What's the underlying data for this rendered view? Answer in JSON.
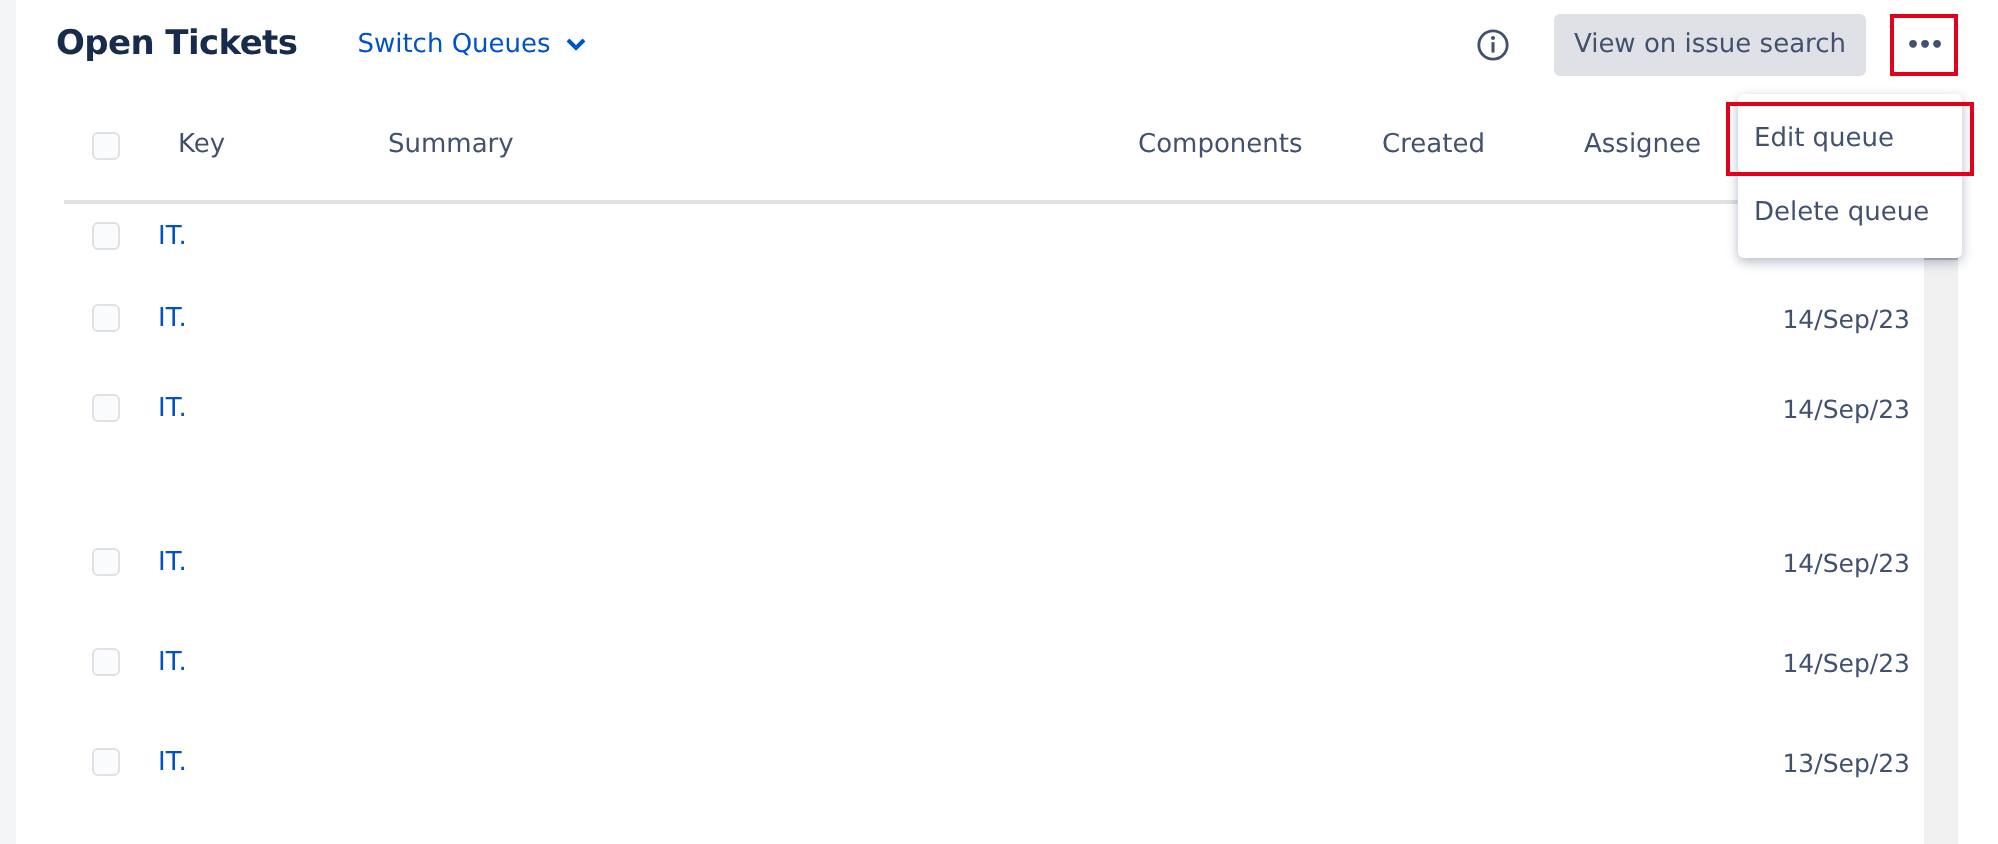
{
  "header": {
    "title": "Open Tickets",
    "switch_label": "Switch Queues",
    "search_button": "View on issue search",
    "more_button": {
      "label": "•••",
      "highlighted": true
    }
  },
  "table": {
    "header_checked": false,
    "columns": [
      "Key",
      "Summary",
      "Components",
      "Created",
      "Assignee"
    ],
    "rows": [
      {
        "checked": false,
        "key": "IT."
      },
      {
        "checked": false,
        "key": "IT.",
        "date": "14/Sep/23"
      },
      {
        "checked": false,
        "key": "IT.",
        "date": "14/Sep/23"
      },
      {
        "checked": false,
        "key": "IT.",
        "date": "14/Sep/23"
      },
      {
        "checked": false,
        "key": "IT.",
        "date": "14/Sep/23"
      },
      {
        "checked": false,
        "key": "IT.",
        "date": "13/Sep/23"
      }
    ]
  },
  "menu": {
    "items": [
      {
        "label": "Edit queue",
        "highlighted": true
      },
      {
        "label": "Delete queue",
        "highlighted": false
      }
    ]
  }
}
